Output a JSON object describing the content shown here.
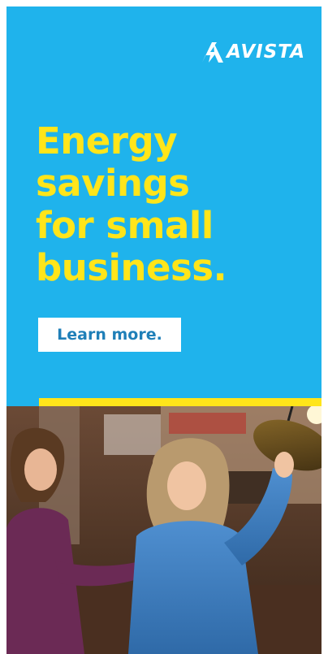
{
  "brand": {
    "logo_text": "AVISTA",
    "logo_icon": "avista-lightning-a-icon"
  },
  "headline": {
    "lines": [
      "Energy",
      "savings",
      "for small",
      "business."
    ]
  },
  "cta": {
    "label": "Learn more."
  },
  "photo": {
    "description_icon": "photo-two-women-restaurant"
  },
  "colors": {
    "background": "#1fb3ec",
    "headline": "#ffe51a",
    "accent_bar": "#ffe51a",
    "button_bg": "#ffffff",
    "button_text": "#1f7fb8"
  }
}
